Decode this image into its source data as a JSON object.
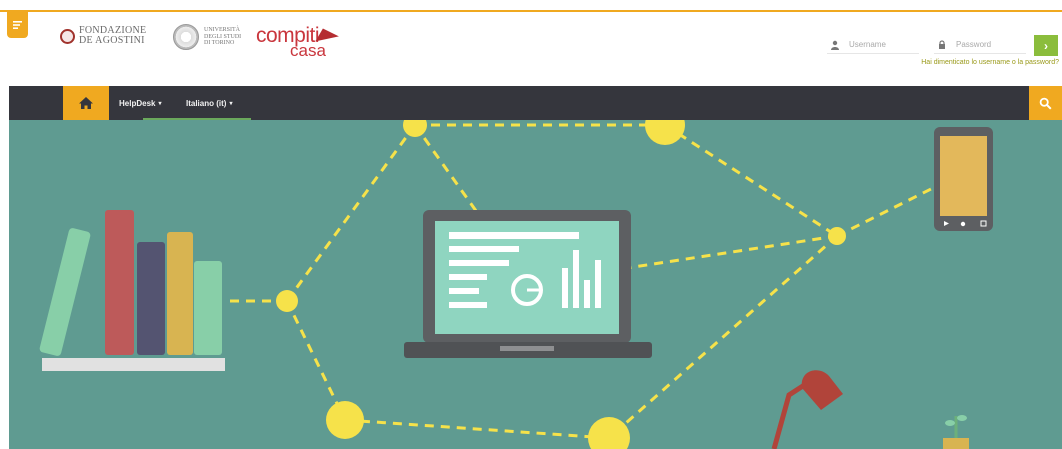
{
  "header": {
    "fondazione_line1": "FONDAZIONE",
    "fondazione_line2": "DE AGOSTINI",
    "unito_line1": "UNIVERSITÀ",
    "unito_line2": "DEGLI STUDI",
    "unito_line3": "DI TORINO",
    "compiti_word1": "compiti",
    "compiti_word2": "casa"
  },
  "login": {
    "username_placeholder": "Username",
    "password_placeholder": "Password",
    "go_label": "›",
    "forgot_link": "Hai dimenticato lo username o la password?"
  },
  "nav": {
    "items": [
      {
        "label": "HelpDesk"
      },
      {
        "label": "Italiano (it)"
      }
    ],
    "caret": "▾"
  },
  "icons": {
    "drawer": "drawer-toggle-icon",
    "user": "user-icon",
    "lock": "lock-icon",
    "home": "home-icon",
    "search": "search-icon"
  },
  "colors": {
    "accent": "#f0a920",
    "navbar": "#35363d",
    "hero_bg": "#5f9b91",
    "go_button": "#8bbd3c",
    "brand_red": "#c9363d",
    "node_yellow": "#f6e24a"
  }
}
